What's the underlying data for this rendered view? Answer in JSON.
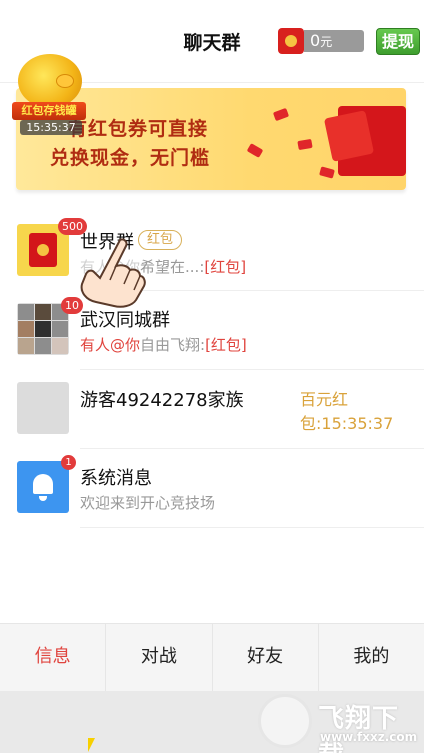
{
  "header": {
    "title": "聊天群",
    "wallet_amount": "0",
    "wallet_unit": "元",
    "withdraw_label": "提现"
  },
  "banner": {
    "line1": "有红包券可直接",
    "line2": "兑换现金，无门槛"
  },
  "pig_badge": {
    "label": "红包存钱罐",
    "time": "15:35:37"
  },
  "chats": [
    {
      "name": "世界群",
      "tag": "红包",
      "badge": "500",
      "message": "有人@你希望在...:[红包]",
      "message_visible_part": "希望在...:",
      "message_red_part": "[红包]",
      "message_prefix": "有人@你"
    },
    {
      "name": "武汉同城群",
      "badge": "10",
      "message_prefix": "有人@你",
      "message_middle": "自由飞翔:",
      "message_red_part": "[红包]"
    },
    {
      "name": "游客49242278家族",
      "extra": "百元红包:15:35:37"
    },
    {
      "name": "系统消息",
      "badge": "1",
      "message": "欢迎来到开心竞技场"
    }
  ],
  "tabs": [
    "信息",
    "对战",
    "好友",
    "我的"
  ],
  "active_tab": 0,
  "watermark": {
    "text": "飞翔下载",
    "url": "www.fxxz.com"
  },
  "colors": {
    "accent_red": "#e0443e",
    "gold": "#d7a23a",
    "withdraw_green": "#4cae36",
    "bell_blue": "#3d95f0"
  }
}
